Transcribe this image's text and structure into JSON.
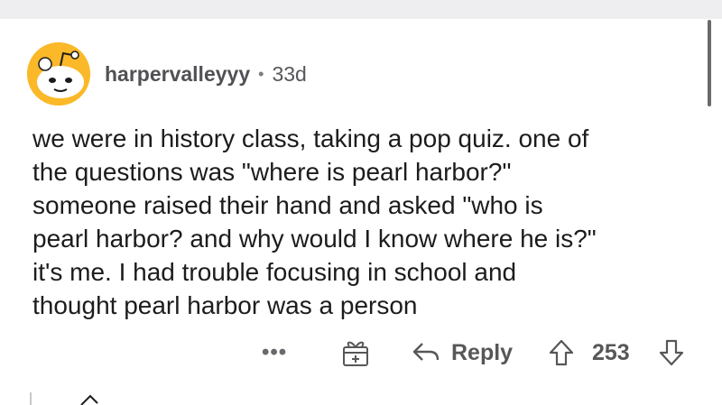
{
  "comment": {
    "username": "harpervalleyyy",
    "separator": "•",
    "age": "33d",
    "body_lines": [
      "we were in history class, taking a pop quiz. one of",
      "the questions was \"where is pearl harbor?\"",
      "someone raised their hand and asked \"who is",
      "pearl harbor? and why would I know where he is?\"",
      "it's me. I had trouble focusing in school and",
      "thought pearl harbor was a person"
    ]
  },
  "actions": {
    "more_label": "•••",
    "reply_label": "Reply",
    "vote_score": "253"
  },
  "icons": {
    "avatar": "snoo-avatar-icon",
    "award": "gift-award-icon",
    "reply": "reply-arrow-icon",
    "upvote": "upvote-arrow-icon",
    "downvote": "downvote-arrow-icon"
  },
  "colors": {
    "avatar_bg": "#fbb828",
    "meta_text": "#57575b",
    "body_text": "#1c1c1c",
    "action_text": "#575757"
  }
}
